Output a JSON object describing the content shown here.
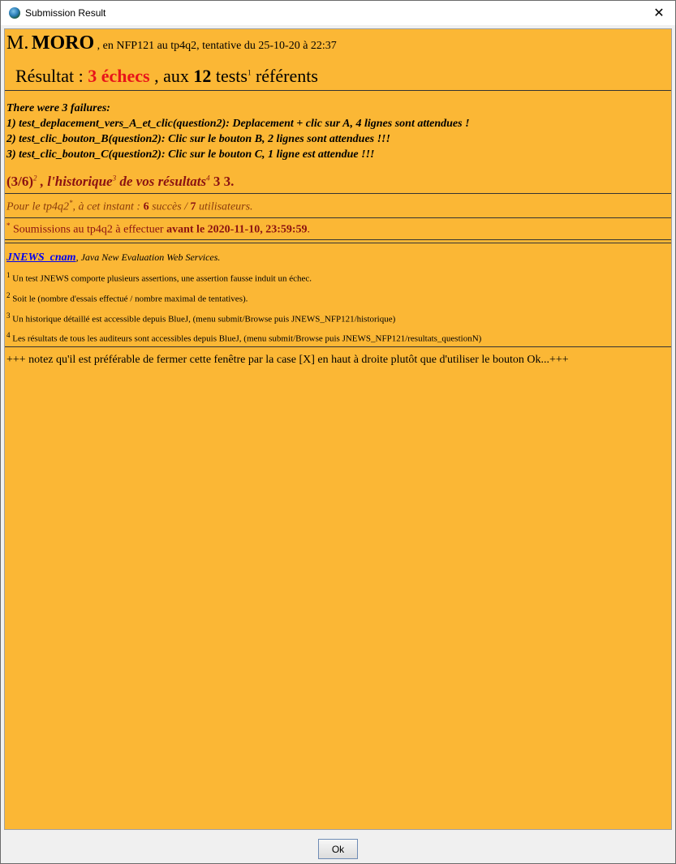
{
  "window": {
    "title": "Submission Result",
    "close_glyph": "✕",
    "icon": "globe-icon"
  },
  "header": {
    "title": "M.",
    "name": "MORO",
    "info": ", en NFP121 au tp4q2, tentative du 25-10-20 à 22:37"
  },
  "result": {
    "label": "Résultat :",
    "failures": "3 échecs",
    "sep": ", aux",
    "tests": "12",
    "tests_label": "tests",
    "tests_sup": "1",
    "tail": "référents"
  },
  "failures": {
    "intro": "There were 3 failures:",
    "items": [
      "1) test_deplacement_vers_A_et_clic(question2): Deplacement + clic sur A, 4 lignes sont attendues !",
      "2) test_clic_bouton_B(question2): Clic sur le bouton B, 2 lignes sont attendues !!!",
      "3) test_clic_bouton_C(question2): Clic sur le bouton C, 1 ligne est attendue !!!"
    ]
  },
  "history": {
    "ratio": "(3/6)",
    "ratio_sup": "2",
    "text": ", l'historique",
    "text_sup": "3",
    "text2": "de vos résultats",
    "text2_sup": "4",
    "values": "3 3."
  },
  "status": {
    "prefix": "Pour le tp4q2",
    "prefix_sup": "*",
    "mid": ", à cet instant :",
    "succ": "6",
    "succ_label": "succès /",
    "users": "7",
    "users_label": "utilisateurs."
  },
  "deadline": {
    "star": "*",
    "text": "Soumissions au tp4q2 à effectuer",
    "bold": "avant le 2020-11-10, 23:59:59",
    "end": "."
  },
  "jnews": {
    "link": "JNEWS_cnam",
    "comma": ",",
    "desc": "Java New Evaluation Web Services."
  },
  "notes": [
    {
      "n": "1",
      "text": "Un test JNEWS comporte plusieurs assertions, une assertion fausse induit un échec."
    },
    {
      "n": "2",
      "text": "Soit le (nombre d'essais effectué / nombre maximal de tentatives)."
    },
    {
      "n": "3",
      "text": "Un historique détaillé est accessible depuis BlueJ, (menu submit/Browse puis JNEWS_NFP121/historique)"
    },
    {
      "n": "4",
      "text": "Les résultats de tous les auditeurs sont accessibles depuis BlueJ, (menu submit/Browse puis JNEWS_NFP121/resultats_questionN)"
    }
  ],
  "footer_note": "+++ notez qu'il est préférable de fermer cette fenêtre par la case [X] en haut à droite plutôt que d'utiliser le bouton Ok...+++",
  "buttons": {
    "ok": "Ok"
  },
  "colors": {
    "background": "#fbb735",
    "failures_red": "#e8141a",
    "history": "#8b1212",
    "link": "#0000ee"
  }
}
